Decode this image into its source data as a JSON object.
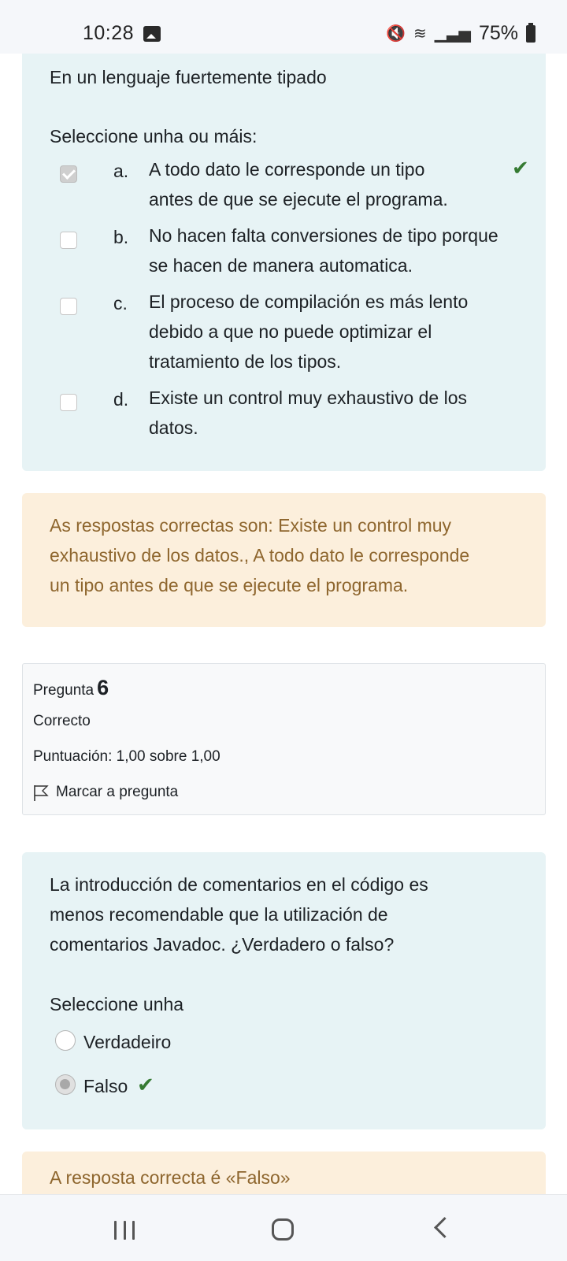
{
  "status_bar": {
    "time": "10:28",
    "battery": "75%"
  },
  "question5": {
    "stem": "En un lenguaje fuertemente tipado",
    "prompt": "Seleccione unha ou máis:",
    "options": [
      {
        "letter": "a.",
        "line1": "A todo dato le corresponde un tipo",
        "line2": "antes de que se ejecute el programa.",
        "line3": ""
      },
      {
        "letter": "b.",
        "line1": "No hacen falta conversiones de tipo porque",
        "line2": "se hacen de manera automatica.",
        "line3": ""
      },
      {
        "letter": "c.",
        "line1": "El proceso de compilación es más lento",
        "line2": "debido a que no puede optimizar el",
        "line3": "tratamiento de los tipos."
      },
      {
        "letter": "d.",
        "line1": "Existe un control muy exhaustivo de los",
        "line2": "datos.",
        "line3": ""
      }
    ],
    "feedback": {
      "line1": "As respostas correctas son: Existe un control muy",
      "line2": "exhaustivo de los datos., A todo dato le corresponde",
      "line3": "un tipo antes de que se ejecute el programa."
    }
  },
  "question6": {
    "info": {
      "label": "Pregunta",
      "number": "6",
      "state": "Correcto",
      "grade": "Puntuación: 1,00 sobre 1,00",
      "flag_label": "Marcar a pregunta"
    },
    "stem_line1": "La introducción de comentarios en el código es",
    "stem_line2": "menos recomendable que la utilización de",
    "stem_line3": "comentarios Javadoc. ¿Verdadero o falso?",
    "prompt": "Seleccione unha",
    "options": [
      {
        "label": "Verdadeiro"
      },
      {
        "label": "Falso"
      }
    ],
    "feedback": "A resposta correcta é «Falso»"
  },
  "colors": {
    "question_bg": "#e7f3f5",
    "feedback_bg": "#fcefdc",
    "feedback_text": "#8e662e",
    "correct_tick": "#357a32"
  }
}
